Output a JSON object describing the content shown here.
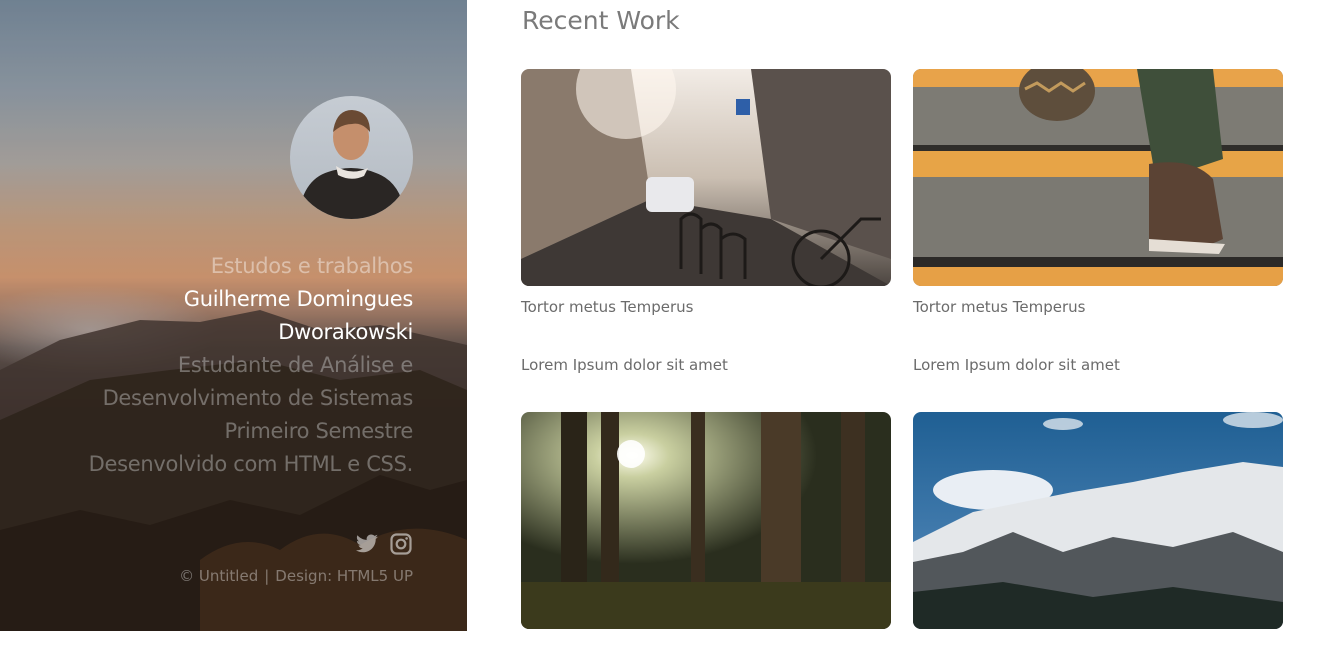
{
  "sidebar": {
    "intro_line": "Estudos e trabalhos",
    "name_line1": "Guilherme Domingues",
    "name_line2": "Dworakowski",
    "course_line1": "Estudante de Análise e",
    "course_line2": "Desenvolvimento de Sistemas",
    "semester": "Primeiro Semestre",
    "built_with": "Desenvolvido com HTML e CSS.",
    "social": [
      {
        "icon": "twitter-icon"
      },
      {
        "icon": "instagram-icon"
      }
    ],
    "credits": {
      "copyright": "© Untitled",
      "separator": "|",
      "design": "Design: HTML5 UP"
    }
  },
  "main": {
    "heading": "Recent Work",
    "items": [
      {
        "title": "Tortor metus Temperus",
        "description": "Lorem Ipsum dolor sit amet",
        "image": "city-street-photo"
      },
      {
        "title": "Tortor metus Temperus",
        "description": "Lorem Ipsum dolor sit amet",
        "image": "stairs-shoe-photo"
      },
      {
        "title": "",
        "description": "",
        "image": "forest-sunlight-photo"
      },
      {
        "title": "",
        "description": "",
        "image": "snowy-mountains-photo"
      }
    ]
  },
  "colors": {
    "heading_text": "#7a7a7a",
    "body_text": "#6b6b6b",
    "sidebar_highlight": "#ffffff"
  }
}
